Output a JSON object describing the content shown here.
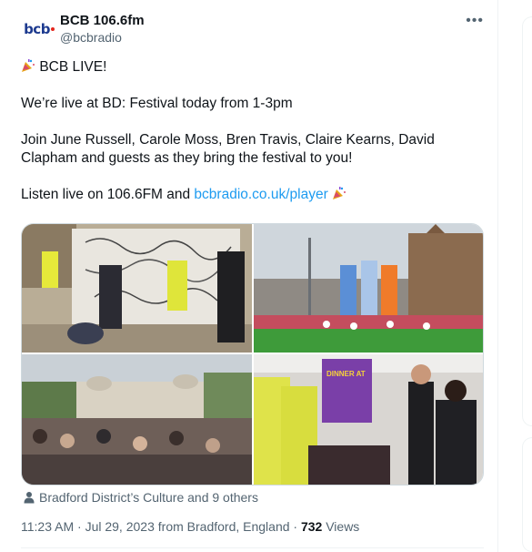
{
  "account": {
    "name": "BCB 106.6fm",
    "handle": "@bcbradio",
    "avatar_text": "bcb"
  },
  "tweet": {
    "line1": "BCB LIVE!",
    "line2": "We’re live at BD: Festival today from 1-3pm",
    "line3": "Join June Russell, Carole Moss, Bren Travis, Claire Kearns, David Clapham and guests as they bring the festival to you!",
    "line4_prefix": "Listen live on 106.6FM and ",
    "line4_link": "bcbradio.co.uk/player"
  },
  "media": [
    {
      "desc_icon": "photo"
    },
    {
      "desc_icon": "photo"
    },
    {
      "desc_icon": "photo"
    },
    {
      "desc_icon": "photo",
      "sign_text": "DINNER AT"
    }
  ],
  "tagged": "Bradford District’s Culture and 9 others",
  "meta": {
    "time": "11:23 AM",
    "date": "Jul 29, 2023",
    "location": "from Bradford, England",
    "views_count": "732",
    "views_label": "Views",
    "separator": "·"
  },
  "colors": {
    "link": "#1d9bf0",
    "secondary": "#536471",
    "border": "#eff3f4"
  },
  "icons": [
    "more-icon",
    "party-popper-icon",
    "person-icon"
  ]
}
